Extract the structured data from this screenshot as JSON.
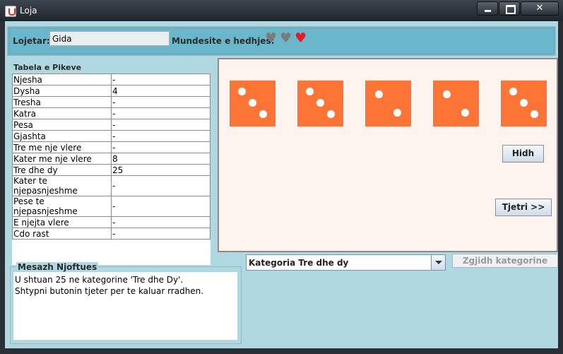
{
  "window": {
    "title": "Loja"
  },
  "player": {
    "label": "Lojetar:",
    "name": "Gida"
  },
  "lives": {
    "label": "Mundesite e hedhjes:",
    "hearts": [
      "#7b7b7b",
      "#7b7b7b",
      "#e8192a"
    ]
  },
  "score_table": {
    "title": "Tabela e Pikeve",
    "rows": [
      {
        "category": "Njesha",
        "score": "-"
      },
      {
        "category": "Dysha",
        "score": "4"
      },
      {
        "category": "Tresha",
        "score": "-"
      },
      {
        "category": "Katra",
        "score": "-"
      },
      {
        "category": "Pesa",
        "score": "-"
      },
      {
        "category": "Gjashta",
        "score": "-"
      },
      {
        "category": "Tre me nje vlere",
        "score": "-"
      },
      {
        "category": "Kater me nje vlere",
        "score": "8"
      },
      {
        "category": "Tre dhe dy",
        "score": "25"
      },
      {
        "category": "Kater te njepasnjeshme",
        "score": "-"
      },
      {
        "category": "Pese te njepasnjeshme",
        "score": "-"
      },
      {
        "category": "E njejta vlere",
        "score": "-"
      },
      {
        "category": "Cdo rast",
        "score": "-"
      }
    ]
  },
  "dice": {
    "color": "#fd7536",
    "values": [
      3,
      3,
      2,
      2,
      3
    ]
  },
  "buttons": {
    "throw": "Hidh",
    "next": "Tjetri >>",
    "choose_category": "Zgjidh kategorine"
  },
  "messages": {
    "title": "Mesazh Njoftues",
    "lines": [
      "U shtuan 25 ne kategorine 'Tre dhe Dy'.",
      "Shtypni butonin tjeter per te kaluar rradhen."
    ]
  },
  "category_select": {
    "selected": "Kategoria Tre dhe dy"
  }
}
